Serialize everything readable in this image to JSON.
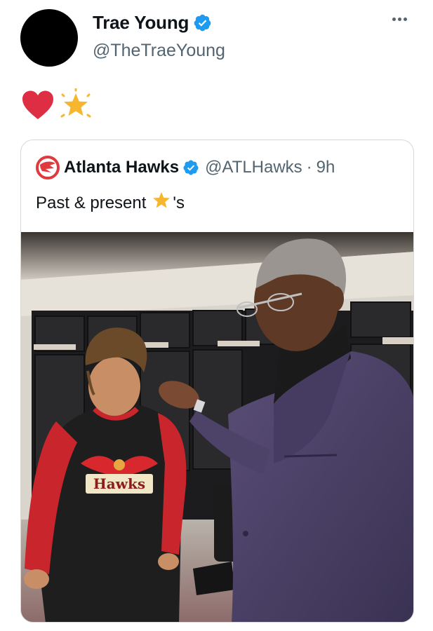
{
  "tweet": {
    "author_name": "Trae Young",
    "author_handle": "@TheTraeYoung",
    "emojis": [
      "red-heart",
      "glowing-star"
    ]
  },
  "quoted_tweet": {
    "author_name": "Atlanta Hawks",
    "author_handle": "@ATLHawks",
    "separator": "·",
    "time": "9h",
    "text_before_emoji": "Past & present",
    "text_after_emoji": "'s",
    "photo": {
      "jersey_text": "Hawks",
      "description_icon": "locker-room-photo"
    }
  },
  "colors": {
    "verified_blue": "#1d9bf0",
    "secondary_text": "#536471",
    "hawks_red": "#e03a3e",
    "star_gold": "#f6b630"
  }
}
